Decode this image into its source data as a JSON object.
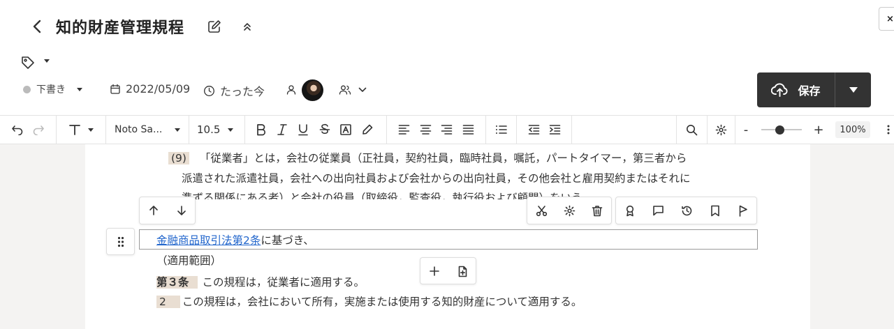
{
  "header": {
    "title": "知的財産管理規程",
    "close_glyph": "×"
  },
  "meta": {
    "status": "下書き",
    "date": "2022/05/09",
    "modified": "たった今"
  },
  "save": {
    "label": "保存"
  },
  "toolbar": {
    "font_family": "Noto Sa...",
    "font_size": "10.5",
    "zoom_minus": "-",
    "zoom_plus": "+",
    "zoom": "100%",
    "zoom_level": 0.45
  },
  "doc": {
    "para9_num": "(9)",
    "para9_line1": "「従業者」とは，会社の従業員（正社員，契約社員，臨時社員，嘱託，パートタイマー，第三者から",
    "para9_line2": "派遣された派遣社員，会社への出向社員および会社からの出向社員，その他会社と雇用契約またはそれに",
    "para9_line3": "準ずる関係にある者）と会社の役員（取締役，監査役，執行役および顧問）をいう。",
    "active_link": "金融商品取引法第2条",
    "active_rest": "に基づき、",
    "heading": "（適用範囲）",
    "article3_num": "第３条",
    "article3_text": "この規程は，従業者に適用する。",
    "para2_num": "2",
    "para2_text": "この規程は，会社において所有，実施または使用する知的財産について適用する。"
  },
  "colors": {
    "save_bg": "#333333",
    "link": "#2266cc",
    "highlight": "#e9ded2",
    "gutter": "#f4f3f2"
  }
}
